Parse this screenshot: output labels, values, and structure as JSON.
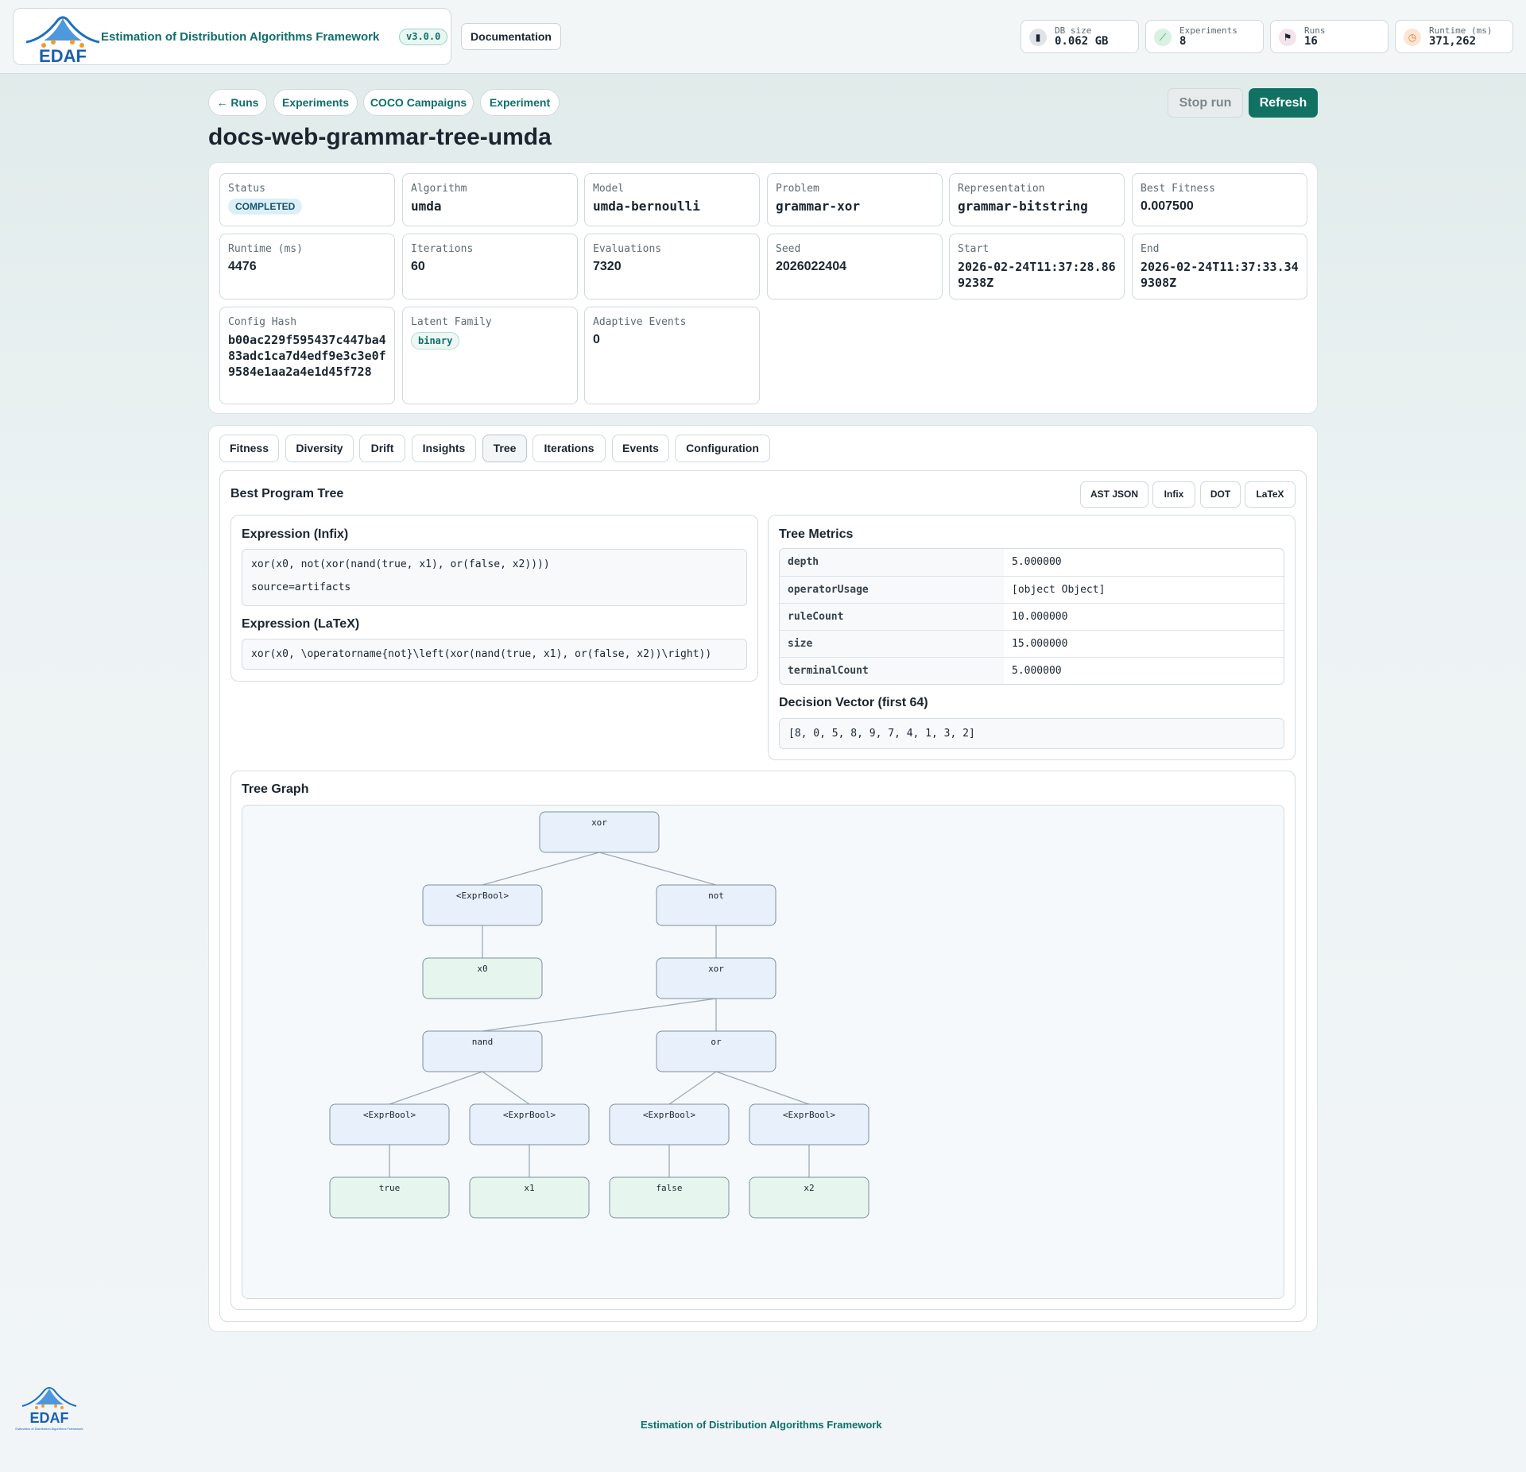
{
  "header": {
    "logo_text": "EDAF",
    "title": "Estimation of Distribution Algorithms Framework",
    "version": "v3.0.0",
    "documentation_label": "Documentation",
    "stats": [
      {
        "label": "DB size",
        "value": "0.062 GB",
        "icon": "database-icon",
        "color": "#dfe4e8"
      },
      {
        "label": "Experiments",
        "value": "8",
        "icon": "flask-icon",
        "color": "#d8f1e2"
      },
      {
        "label": "Runs",
        "value": "16",
        "icon": "checkered-flag-icon",
        "color": "#f3e3ea"
      },
      {
        "label": "Runtime (ms)",
        "value": "371,262",
        "icon": "stopwatch-icon",
        "color": "#fbe6d6"
      }
    ]
  },
  "nav": {
    "back_runs": "← Runs",
    "experiments": "Experiments",
    "coco": "COCO Campaigns",
    "experiment": "Experiment",
    "stop_run": "Stop run",
    "refresh": "Refresh"
  },
  "run": {
    "title": "docs-web-grammar-tree-umda",
    "fields": {
      "status": {
        "label": "Status",
        "value": "COMPLETED"
      },
      "algorithm": {
        "label": "Algorithm",
        "value": "umda"
      },
      "model": {
        "label": "Model",
        "value": "umda-bernoulli"
      },
      "problem": {
        "label": "Problem",
        "value": "grammar-xor"
      },
      "representation": {
        "label": "Representation",
        "value": "grammar-bitstring"
      },
      "best_fitness": {
        "label": "Best Fitness",
        "value": "0.007500"
      },
      "runtime": {
        "label": "Runtime (ms)",
        "value": "4476"
      },
      "iterations": {
        "label": "Iterations",
        "value": "60"
      },
      "evaluations": {
        "label": "Evaluations",
        "value": "7320"
      },
      "seed": {
        "label": "Seed",
        "value": "2026022404"
      },
      "start": {
        "label": "Start",
        "value": "2026-02-24T11:37:28.869238Z"
      },
      "end": {
        "label": "End",
        "value": "2026-02-24T11:37:33.349308Z"
      },
      "config_hash": {
        "label": "Config Hash",
        "value": "b00ac229f595437c447ba483adc1ca7d4edf9e3c3e0f9584e1aa2a4e1d45f728"
      },
      "latent_family": {
        "label": "Latent Family",
        "value": "binary"
      },
      "adaptive_events": {
        "label": "Adaptive Events",
        "value": "0"
      }
    }
  },
  "tabs": [
    "Fitness",
    "Diversity",
    "Drift",
    "Insights",
    "Tree",
    "Iterations",
    "Events",
    "Configuration"
  ],
  "tree_panel": {
    "title": "Best Program Tree",
    "formats": [
      "AST JSON",
      "Infix",
      "DOT",
      "LaTeX"
    ],
    "infix_title": "Expression (Infix)",
    "infix_expr": "xor(x0, not(xor(nand(true, x1), or(false, x2))))",
    "infix_source": "source=artifacts",
    "latex_title": "Expression (LaTeX)",
    "latex_expr": "xor(x0, \\operatorname{not}\\left(xor(nand(true, x1), or(false, x2))\\right))",
    "metrics_title": "Tree Metrics",
    "metrics": [
      {
        "key": "depth",
        "value": "5.000000"
      },
      {
        "key": "operatorUsage",
        "value": "[object Object]"
      },
      {
        "key": "ruleCount",
        "value": "10.000000"
      },
      {
        "key": "size",
        "value": "15.000000"
      },
      {
        "key": "terminalCount",
        "value": "5.000000"
      }
    ],
    "decision_title": "Decision Vector (first 64)",
    "decision_vector": "[8, 0, 5, 8, 9, 7, 4, 1, 3, 2]",
    "graph_title": "Tree Graph",
    "graph": {
      "nodes": [
        {
          "id": "n1",
          "label": "xor",
          "kind": "op"
        },
        {
          "id": "n2",
          "label": "<ExprBool>",
          "kind": "op"
        },
        {
          "id": "n3",
          "label": "not",
          "kind": "op"
        },
        {
          "id": "n4",
          "label": "x0",
          "kind": "leaf"
        },
        {
          "id": "n5",
          "label": "xor",
          "kind": "op"
        },
        {
          "id": "n6",
          "label": "nand",
          "kind": "op"
        },
        {
          "id": "n7",
          "label": "or",
          "kind": "op"
        },
        {
          "id": "n8",
          "label": "<ExprBool>",
          "kind": "op"
        },
        {
          "id": "n9",
          "label": "<ExprBool>",
          "kind": "op"
        },
        {
          "id": "n10",
          "label": "<ExprBool>",
          "kind": "op"
        },
        {
          "id": "n11",
          "label": "<ExprBool>",
          "kind": "op"
        },
        {
          "id": "n12",
          "label": "true",
          "kind": "leaf"
        },
        {
          "id": "n13",
          "label": "x1",
          "kind": "leaf"
        },
        {
          "id": "n14",
          "label": "false",
          "kind": "leaf"
        },
        {
          "id": "n15",
          "label": "x2",
          "kind": "leaf"
        }
      ],
      "edges": [
        [
          "n1",
          "n2"
        ],
        [
          "n1",
          "n3"
        ],
        [
          "n2",
          "n4"
        ],
        [
          "n3",
          "n5"
        ],
        [
          "n5",
          "n6"
        ],
        [
          "n5",
          "n7"
        ],
        [
          "n6",
          "n8"
        ],
        [
          "n6",
          "n9"
        ],
        [
          "n7",
          "n10"
        ],
        [
          "n7",
          "n11"
        ],
        [
          "n8",
          "n12"
        ],
        [
          "n9",
          "n13"
        ],
        [
          "n10",
          "n14"
        ],
        [
          "n11",
          "n15"
        ]
      ]
    }
  },
  "footer": {
    "logo_text": "EDAF",
    "logo_caption": "Estimation of Distribution Algorithms Framework",
    "title": "Estimation of Distribution Algorithms Framework"
  },
  "colors": {
    "accent": "#117264",
    "op_node_fill": "#e7f0fb",
    "leaf_node_fill": "#e6f6ee"
  }
}
